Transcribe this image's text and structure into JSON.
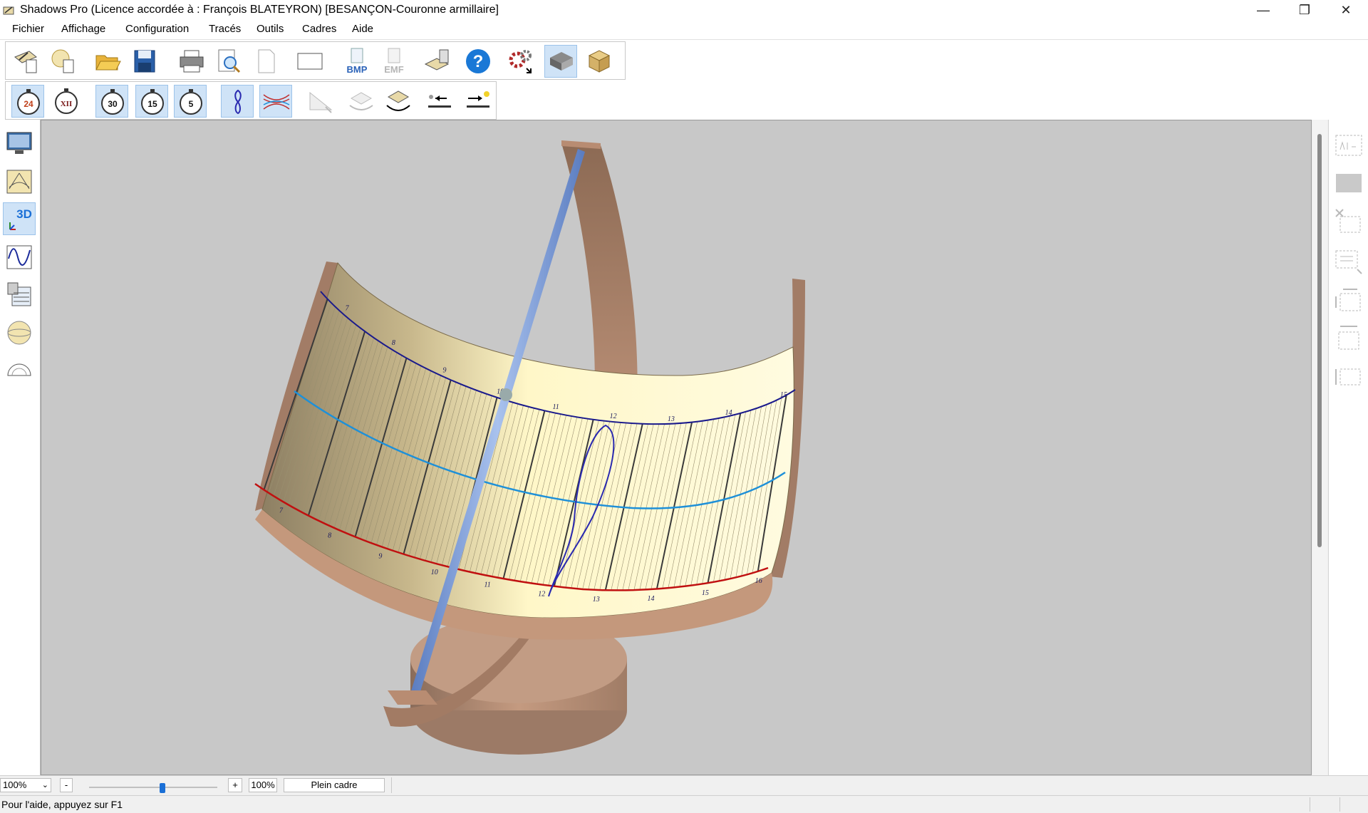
{
  "window": {
    "title": "Shadows Pro  (Licence accordée à :  François BLATEYRON) [BESANÇON-Couronne armillaire]",
    "minimize_glyph": "—",
    "restore_glyph": "❐",
    "close_glyph": "✕"
  },
  "menu": {
    "items": [
      "Fichier",
      "Affichage",
      "Configuration",
      "Tracés",
      "Outils",
      "Cadres",
      "Aide"
    ]
  },
  "toolbar1": {
    "bmp_label": "BMP",
    "emf_label": "EMF",
    "help_label": "?"
  },
  "toolbar2": {
    "clock24_label": "24",
    "clockXII_label": "XII",
    "min30_label": "30",
    "min15_label": "15",
    "min5_label": "5"
  },
  "leftbar": {
    "view3d_label": "3D"
  },
  "dial": {
    "top_hours": [
      "7",
      "8",
      "9",
      "10",
      "11",
      "12",
      "13",
      "14",
      "15"
    ],
    "bottom_hours": [
      "7",
      "8",
      "9",
      "10",
      "11",
      "12",
      "13",
      "14",
      "15",
      "16"
    ],
    "colors": {
      "top_curve": "#1a1a8c",
      "middle_curve": "#1e90d8",
      "bottom_curve": "#c01010",
      "analemma": "#2a2ab0",
      "frame": "#b08468",
      "gnomon": "#7fa0d8"
    }
  },
  "zoombar": {
    "zoom_value": "100%",
    "minus_label": "-",
    "plus_label": "+",
    "zoom_percent": "100%",
    "fullframe_label": "Plein cadre",
    "slider_level": 0.5
  },
  "status": {
    "message": "Pour l'aide, appuyez sur F1"
  }
}
